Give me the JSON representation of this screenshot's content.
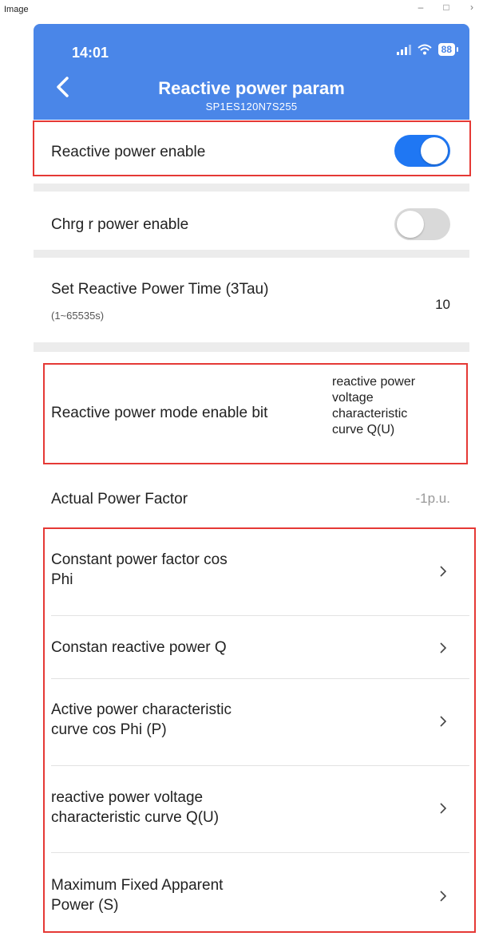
{
  "window": {
    "title": "Image"
  },
  "status": {
    "time": "14:01",
    "battery": "88"
  },
  "header": {
    "title": "Reactive power param",
    "serial": "SP1ES120N7S255"
  },
  "settings": {
    "reactive_enable": {
      "label": "Reactive power enable",
      "state": "on"
    },
    "chrg_enable": {
      "label": "Chrg r power enable",
      "state": "off"
    },
    "time": {
      "label": "Set Reactive Power Time (3Tau)",
      "hint": "(1~65535s)",
      "value": "10"
    },
    "mode": {
      "label": "Reactive power mode enable bit",
      "value_lines": [
        "reactive power",
        "voltage",
        "characteristic",
        "curve Q(U)"
      ]
    },
    "power_factor": {
      "label": "Actual Power Factor",
      "value": "-1p.u."
    }
  },
  "menu": [
    {
      "lines": [
        "Constant power factor cos",
        "Phi"
      ]
    },
    {
      "lines": [
        "Constan reactive power Q"
      ]
    },
    {
      "lines": [
        "Active power characteristic",
        "curve cos Phi (P)"
      ]
    },
    {
      "lines": [
        "reactive power voltage",
        "characteristic curve Q(U)"
      ]
    },
    {
      "lines": [
        "Maximum Fixed Apparent",
        "Power (S)"
      ]
    }
  ],
  "colors": {
    "header": "#4a86e8",
    "toggle_on": "#1f77f3",
    "highlight": "#e53935"
  }
}
